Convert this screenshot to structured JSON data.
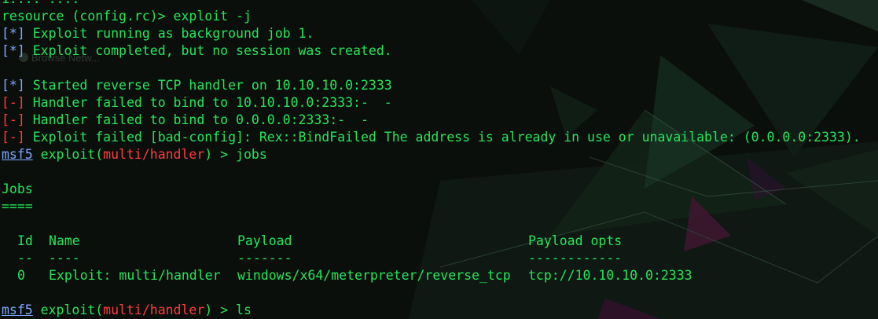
{
  "terminal": {
    "line_top_clipped": "1.... ....",
    "line_resource": "resource (config.rc)> exploit -j",
    "info_tag": "[*]",
    "err_tag": "[-]",
    "msg_job": " Exploit running as background job 1.",
    "msg_nosession": " Exploit completed, but no session was created.",
    "msg_handler": " Started reverse TCP handler on 10.10.10.0:2333",
    "msg_bind1": " Handler failed to bind to 10.10.10.0:2333:-  -",
    "msg_bind2": " Handler failed to bind to 0.0.0.0:2333:-  -",
    "msg_failed": " Exploit failed [bad-config]: Rex::BindFailed The address is already in use or unavailable: (0.0.0.0:2333).",
    "prompt_msf": "msf5",
    "prompt_exploit": " exploit(",
    "prompt_module": "multi/handler",
    "prompt_close": ") > ",
    "cmd_jobs": "jobs",
    "jobs_title": "Jobs",
    "jobs_underline": "====",
    "cmd_ls": "ls",
    "ghost_text": "Browse Netw..."
  },
  "jobs_table": {
    "headers": [
      "Id",
      "Name",
      "Payload",
      "Payload opts"
    ],
    "underlines": [
      "--",
      "----",
      "-------",
      "------------"
    ],
    "rows": [
      [
        "0",
        "Exploit: multi/handler",
        "windows/x64/meterpreter/reverse_tcp",
        "tcp://10.10.10.0:2333"
      ]
    ]
  },
  "colors": {
    "background": "#0b0f0c",
    "text_green": "#23e65a",
    "info_blue": "#7da7ff",
    "error_red": "#ff3b3b"
  }
}
